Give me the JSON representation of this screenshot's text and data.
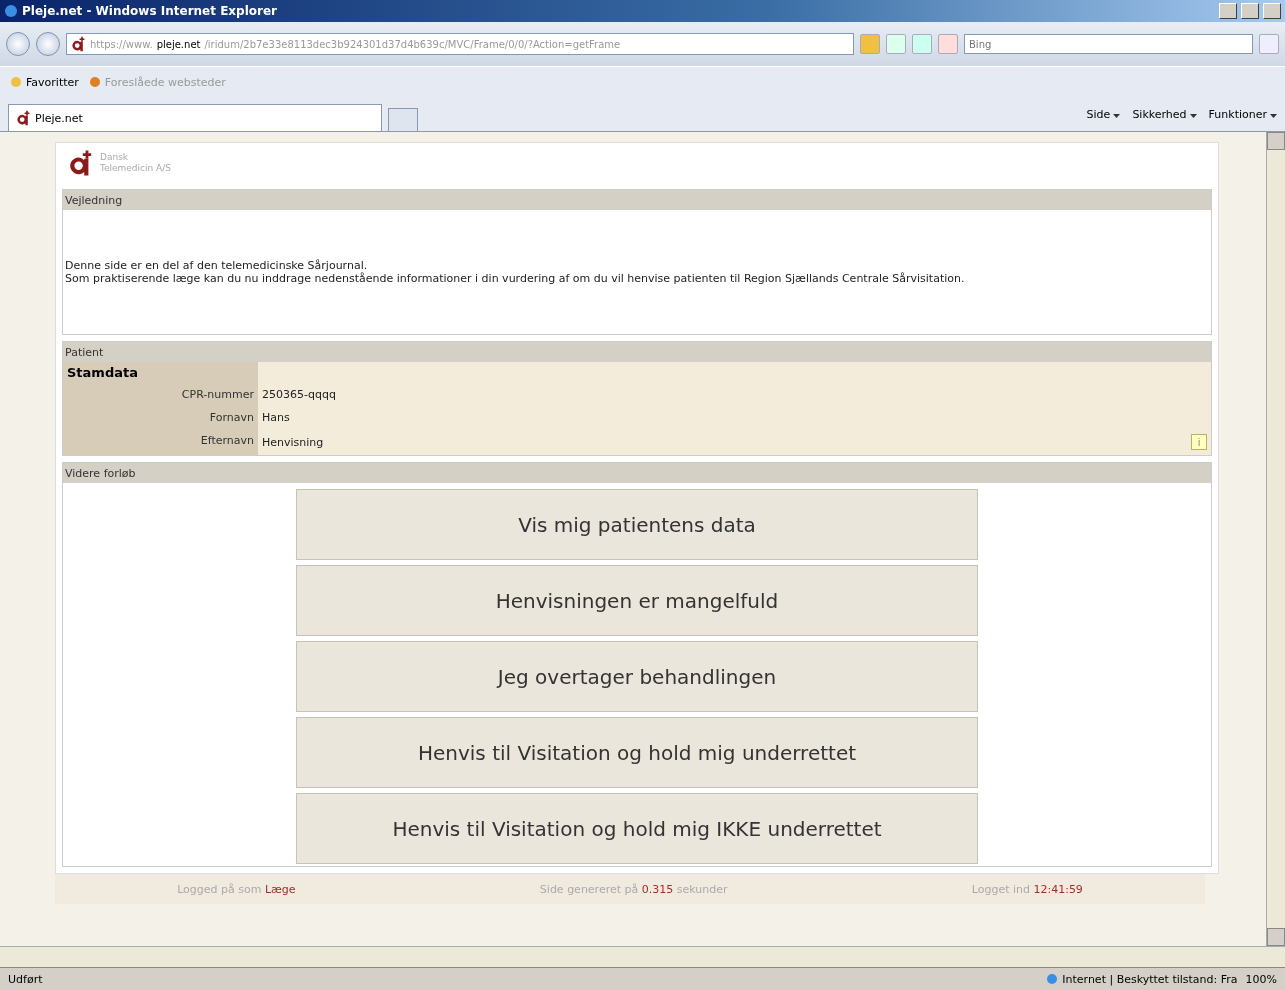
{
  "window": {
    "title": "Pleje.net - Windows Internet Explorer"
  },
  "address_bar": {
    "url_prefix": "https://www.",
    "url_domain": "pleje.net",
    "url_rest": "/iridum/2b7e33e8113dec3b924301d37d4b639c/MVC/Frame/0/0/?Action=getFrame",
    "search_placeholder": "Bing"
  },
  "favorites_bar": {
    "favorites": "Favoritter",
    "suggested": "Foreslåede websteder",
    "suggested_disabled": true
  },
  "tab": {
    "label": "Pleje.net",
    "selected": true
  },
  "command_bar": [
    "Side",
    "Sikkerhed",
    "Funktioner"
  ],
  "page": {
    "logo": {
      "line_1": "Dansk",
      "line_2": "Telemedicin A/S"
    },
    "guidance": {
      "header": "Vejledning",
      "lines": [
        "Denne side er en del af den telemedicinske Sårjournal.",
        "Som praktiserende læge kan du nu inddrage nedenstående informationer i din vurdering af om du vil henvise patienten til Region Sjællands Centrale Sårvisitation."
      ]
    },
    "patient": {
      "header": "Patient",
      "group": "Stamdata",
      "fields": [
        {
          "label": "CPR-nummer",
          "value": "250365-qqqq"
        },
        {
          "label": "Fornavn",
          "value": "Hans"
        },
        {
          "label": "Efternavn",
          "value": "Henvisning"
        }
      ],
      "info_button": "i"
    },
    "next_steps": {
      "header": "Videre forløb",
      "buttons": [
        "Vis mig patientens data",
        "Henvisningen er mangelfuld",
        "Jeg overtager behandlingen",
        "Henvis til Visitation og hold mig underrettet",
        "Henvis til Visitation og hold mig IKKE underrettet"
      ]
    },
    "footer": [
      {
        "prefix": "Logged på som",
        "value": "Læge"
      },
      {
        "prefix": "Side genereret på",
        "value": "0.315",
        "suffix": "sekunder"
      },
      {
        "prefix": "Logget ind",
        "value": "12:41:59"
      }
    ]
  },
  "status_bar": {
    "status": "Udført",
    "zone": "Internet | Beskyttet tilstand: Fra",
    "zoom": "100%"
  }
}
